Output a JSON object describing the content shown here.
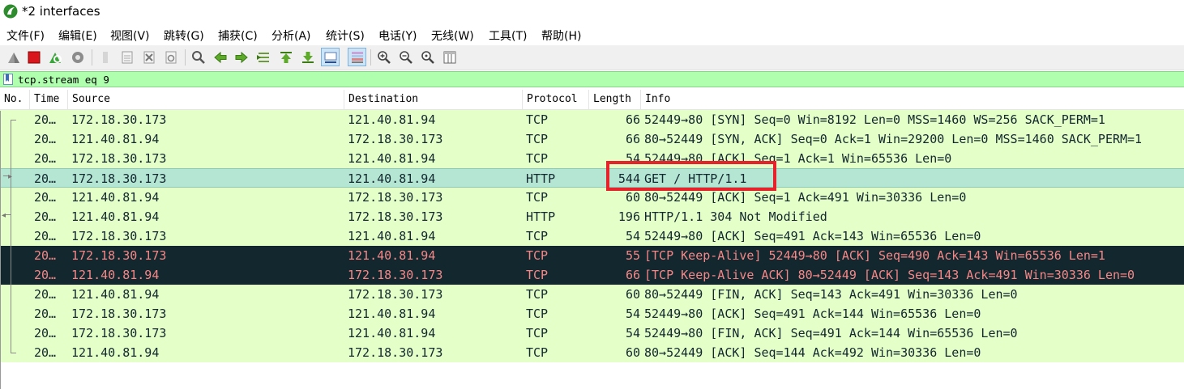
{
  "window": {
    "title": "*2 interfaces",
    "app_icon": "wireshark-fin-icon"
  },
  "menu": [
    "文件(F)",
    "编辑(E)",
    "视图(V)",
    "跳转(G)",
    "捕获(C)",
    "分析(A)",
    "统计(S)",
    "电话(Y)",
    "无线(W)",
    "工具(T)",
    "帮助(H)"
  ],
  "toolbar": {
    "buttons": [
      "start-capture-icon",
      "stop-capture-icon",
      "restart-capture-icon",
      "capture-options-icon",
      "open-file-icon",
      "save-file-icon",
      "close-file-icon",
      "reload-file-icon",
      "find-packet-icon",
      "go-back-icon",
      "go-forward-icon",
      "go-to-packet-icon",
      "go-first-icon",
      "go-last-icon",
      "autoscroll-icon",
      "colorize-icon",
      "zoom-in-icon",
      "zoom-out-icon",
      "zoom-normal-icon",
      "resize-columns-icon"
    ]
  },
  "filter": {
    "value": "tcp.stream eq 9",
    "bookmark_icon": "bookmark-icon"
  },
  "columns": [
    "No.",
    "Time",
    "Source",
    "Destination",
    "Protocol",
    "Length",
    "Info"
  ],
  "colors": {
    "tcp_row_bg": "#e4ffc7",
    "selected_row_bg": "#b5e6d4",
    "bad_row_bg": "#12272e",
    "bad_row_fg": "#f78787",
    "filter_bg": "#afffaf",
    "highlight": "#e8222a"
  },
  "packets": [
    {
      "no": "20…",
      "src": "172.18.30.173",
      "dst": "121.40.81.94",
      "proto": "TCP",
      "len": "66",
      "info": "52449→80 [SYN] Seq=0 Win=8192 Len=0 MSS=1460 WS=256 SACK_PERM=1"
    },
    {
      "no": "20…",
      "src": "121.40.81.94",
      "dst": "172.18.30.173",
      "proto": "TCP",
      "len": "66",
      "info": "80→52449 [SYN, ACK] Seq=0 Ack=1 Win=29200 Len=0 MSS=1460 SACK_PERM=1"
    },
    {
      "no": "20…",
      "src": "172.18.30.173",
      "dst": "121.40.81.94",
      "proto": "TCP",
      "len": "54",
      "info": "52449→80 [ACK] Seq=1 Ack=1 Win=65536 Len=0"
    },
    {
      "no": "20…",
      "src": "172.18.30.173",
      "dst": "121.40.81.94",
      "proto": "HTTP",
      "len": "544",
      "info": "GET / HTTP/1.1"
    },
    {
      "no": "20…",
      "src": "121.40.81.94",
      "dst": "172.18.30.173",
      "proto": "TCP",
      "len": "60",
      "info": "80→52449 [ACK] Seq=1 Ack=491 Win=30336 Len=0"
    },
    {
      "no": "20…",
      "src": "121.40.81.94",
      "dst": "172.18.30.173",
      "proto": "HTTP",
      "len": "196",
      "info": "HTTP/1.1 304 Not Modified"
    },
    {
      "no": "20…",
      "src": "172.18.30.173",
      "dst": "121.40.81.94",
      "proto": "TCP",
      "len": "54",
      "info": "52449→80 [ACK] Seq=491 Ack=143 Win=65536 Len=0"
    },
    {
      "no": "20…",
      "src": "172.18.30.173",
      "dst": "121.40.81.94",
      "proto": "TCP",
      "len": "55",
      "info": "[TCP Keep-Alive] 52449→80 [ACK] Seq=490 Ack=143 Win=65536 Len=1"
    },
    {
      "no": "20…",
      "src": "121.40.81.94",
      "dst": "172.18.30.173",
      "proto": "TCP",
      "len": "66",
      "info": "[TCP Keep-Alive ACK] 80→52449 [ACK] Seq=143 Ack=491 Win=30336 Len=0"
    },
    {
      "no": "20…",
      "src": "121.40.81.94",
      "dst": "172.18.30.173",
      "proto": "TCP",
      "len": "60",
      "info": "80→52449 [FIN, ACK] Seq=143 Ack=491 Win=30336 Len=0"
    },
    {
      "no": "20…",
      "src": "172.18.30.173",
      "dst": "121.40.81.94",
      "proto": "TCP",
      "len": "54",
      "info": "52449→80 [ACK] Seq=491 Ack=144 Win=65536 Len=0"
    },
    {
      "no": "20…",
      "src": "172.18.30.173",
      "dst": "121.40.81.94",
      "proto": "TCP",
      "len": "54",
      "info": "52449→80 [FIN, ACK] Seq=491 Ack=144 Win=65536 Len=0"
    },
    {
      "no": "20…",
      "src": "121.40.81.94",
      "dst": "172.18.30.173",
      "proto": "TCP",
      "len": "60",
      "info": "80→52449 [ACK] Seq=144 Ack=492 Win=30336 Len=0"
    }
  ]
}
